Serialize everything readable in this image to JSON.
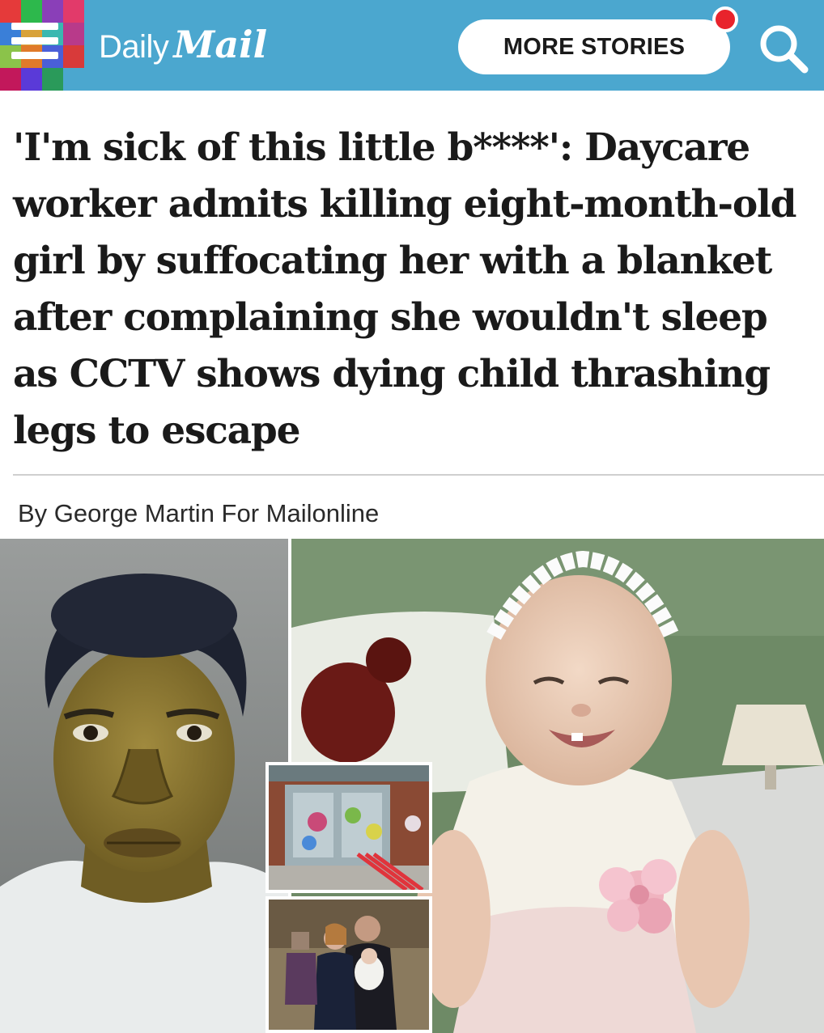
{
  "header": {
    "logo_daily": "Daily",
    "logo_mail": "Mail",
    "more_stories_label": "MORE STORIES"
  },
  "article": {
    "headline": "'I'm sick of this little b****': Daycare worker admits killing eight-month-old girl by suffocating her with a blanket after complaining she wouldn't sleep as CCTV shows dying child thrashing legs to escape",
    "byline": "By George Martin For Mailonline"
  },
  "icons": {
    "menu": "hamburger-menu-icon",
    "search": "search-icon",
    "notification": "notification-dot-icon"
  },
  "colors": {
    "header_bg": "#4ba7cf",
    "notification": "#e8232c",
    "headline_text": "#1a1a1a"
  }
}
